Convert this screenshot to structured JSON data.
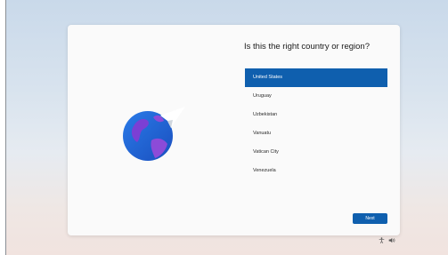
{
  "setup": {
    "title": "Is this the right country or region?",
    "regions": [
      {
        "label": "United States",
        "selected": true
      },
      {
        "label": "Uruguay",
        "selected": false
      },
      {
        "label": "Uzbekistan",
        "selected": false
      },
      {
        "label": "Vanuatu",
        "selected": false
      },
      {
        "label": "Vatican City",
        "selected": false
      },
      {
        "label": "Venezuela",
        "selected": false
      }
    ],
    "next_label": "Next"
  },
  "tray": {
    "icons": [
      "accessibility-icon",
      "volume-icon"
    ]
  },
  "colors": {
    "accent": "#0f5fae",
    "card": "#fafafa",
    "globe_blue": "#1b63d6",
    "globe_purple": "#8c4bd8"
  }
}
